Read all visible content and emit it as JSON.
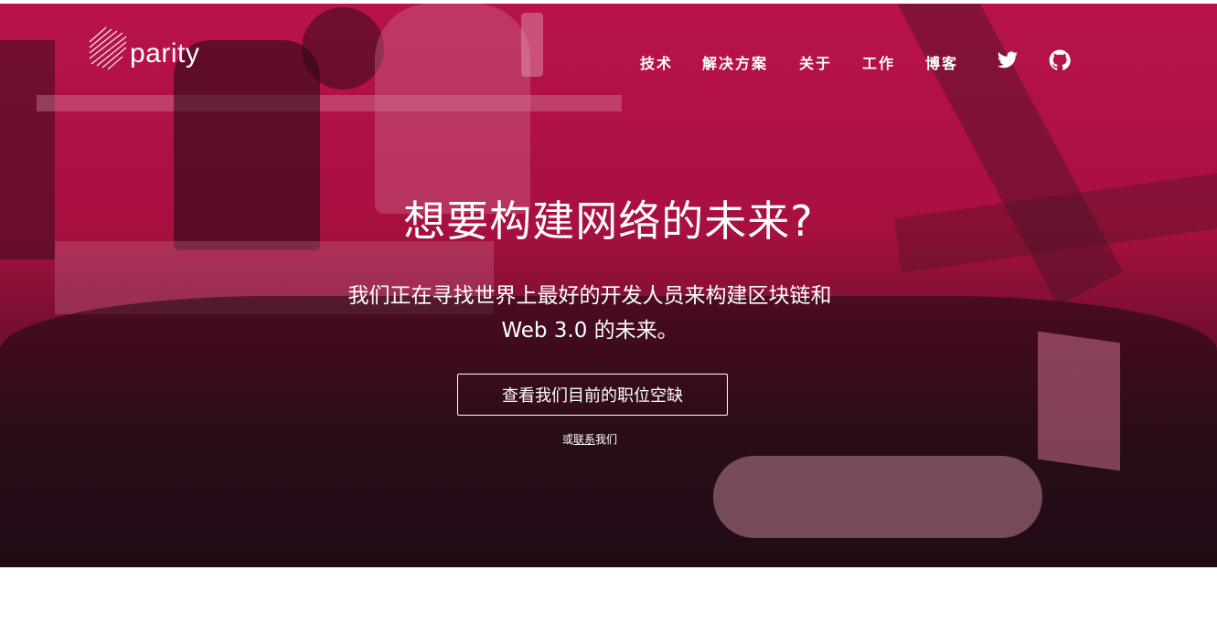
{
  "brand": {
    "name": "parity"
  },
  "nav": {
    "items": [
      "技术",
      "解决方案",
      "关于",
      "工作",
      "博客"
    ],
    "icons": [
      "twitter-icon",
      "github-icon"
    ]
  },
  "hero": {
    "headline": "想要构建网络的未来?",
    "subline_1": "我们正在寻找世界上最好的开发人员来构建区块链和",
    "subline_2": "Web 3.0 的未来。",
    "cta_label": "查看我们目前的职位空缺",
    "contact_prefix": "或",
    "contact_link": "联系",
    "contact_suffix": "我们"
  },
  "colors": {
    "accent": "#b8124c",
    "text": "#ffffff",
    "dark": "#2a111c"
  }
}
